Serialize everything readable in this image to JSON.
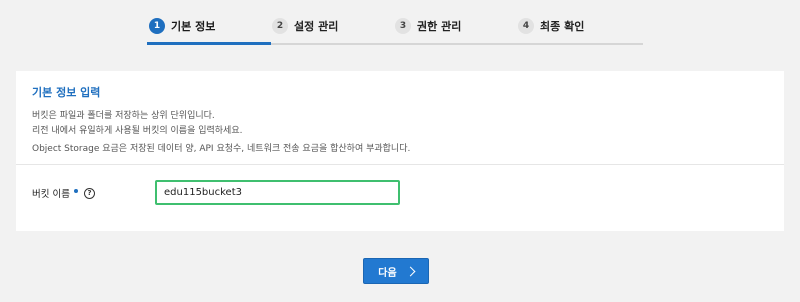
{
  "stepper": {
    "steps": [
      {
        "number": "1",
        "label": "기본 정보",
        "active": true
      },
      {
        "number": "2",
        "label": "설정 관리",
        "active": false
      },
      {
        "number": "3",
        "label": "권한 관리",
        "active": false
      },
      {
        "number": "4",
        "label": "최종 확인",
        "active": false
      }
    ]
  },
  "card": {
    "title": "기본 정보 입력",
    "descriptions": [
      "버킷은 파일과 폴더를 저장하는 상위 단위입니다.",
      "리전 내에서 유일하게 사용될 버킷의 이름을 입력하세요.",
      "Object Storage 요금은 저장된 데이터 양, API 요청수, 네트워크 전송 요금을 합산하여 부과합니다."
    ],
    "field": {
      "label": "버킷 이름",
      "help_glyph": "?",
      "value": "edu115bucket3"
    }
  },
  "footer": {
    "next_label": "다음"
  },
  "colors": {
    "accent": "#1f6fbf",
    "input_focus_border": "#3fbf6f",
    "button_bg": "#2279d1"
  }
}
